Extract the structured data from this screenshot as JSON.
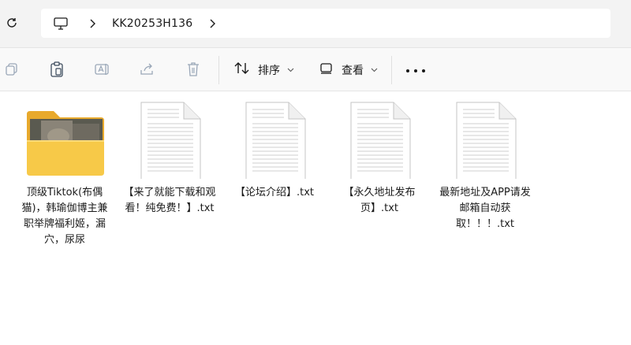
{
  "breadcrumb": {
    "path": "KK20253H136"
  },
  "toolbar": {
    "sort_label": "排序",
    "view_label": "查看"
  },
  "files": [
    {
      "name": "顶级Tiktok(布偶猫)，韩瑜伽博主兼职举牌福利姬，漏穴，尿尿",
      "type": "folder"
    },
    {
      "name": "【来了就能下载和观看！纯免费！】.txt",
      "type": "txt"
    },
    {
      "name": "【论坛介绍】.txt",
      "type": "txt"
    },
    {
      "name": "【永久地址发布页】.txt",
      "type": "txt"
    },
    {
      "name": "最新地址及APP请发邮箱自动获取！！！.txt",
      "type": "txt"
    }
  ],
  "colors": {
    "folder_front": "#f7c948",
    "folder_back": "#e8a92c",
    "accent": "#0067c0"
  }
}
